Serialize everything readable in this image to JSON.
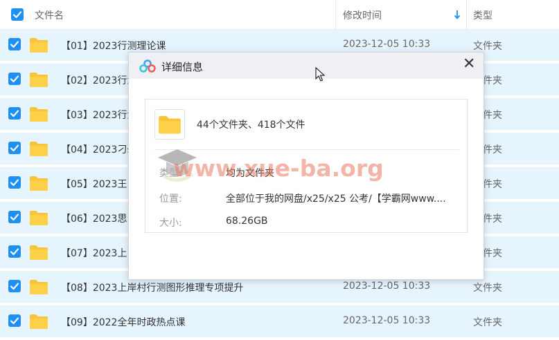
{
  "header": {
    "col_name": "文件名",
    "col_modified": "修改时间",
    "col_type": "类型",
    "sort_icon": "arrow-down-icon"
  },
  "rows": [
    {
      "name": "【01】2023行测理论课",
      "time": "2023-12-05 10:33",
      "type": "文件夹"
    },
    {
      "name": "【02】2023行测",
      "time": "",
      "type": "件夹"
    },
    {
      "name": "【03】2023行测",
      "time": "",
      "type": "件夹"
    },
    {
      "name": "【04】2023刁s",
      "time": "",
      "type": "件夹"
    },
    {
      "name": "【05】2023王",
      "time": "",
      "type": "件夹"
    },
    {
      "name": "【06】2023思",
      "time": "",
      "type": "件夹"
    },
    {
      "name": "【07】2023上",
      "time": "",
      "type": "件夹"
    },
    {
      "name": "【08】2023上岸村行测图形推理专项提升",
      "time": "2023-12-05 10:33",
      "type": "文件夹"
    },
    {
      "name": "【09】2022全年时政热点课",
      "time": "2023-12-05 10:33",
      "type": "文件夹"
    }
  ],
  "dialog": {
    "title": "详细信息",
    "close_icon": "close-icon",
    "count_text": "44个文件夹、418个文件",
    "type_label": "类型:",
    "type_value": "均为文件夹",
    "location_label": "位置:",
    "location_value": "全部位于我的网盘/x25/x25 公考/【学霸网www....",
    "size_label": "大小:",
    "size_value": "68.26GB"
  },
  "watermark": "www.xue-ba.org",
  "colors": {
    "checkbox": "#1e90f5",
    "row_selected": "#e6f4fe",
    "folder": "#f7c43a",
    "watermark": "#e8785f"
  }
}
